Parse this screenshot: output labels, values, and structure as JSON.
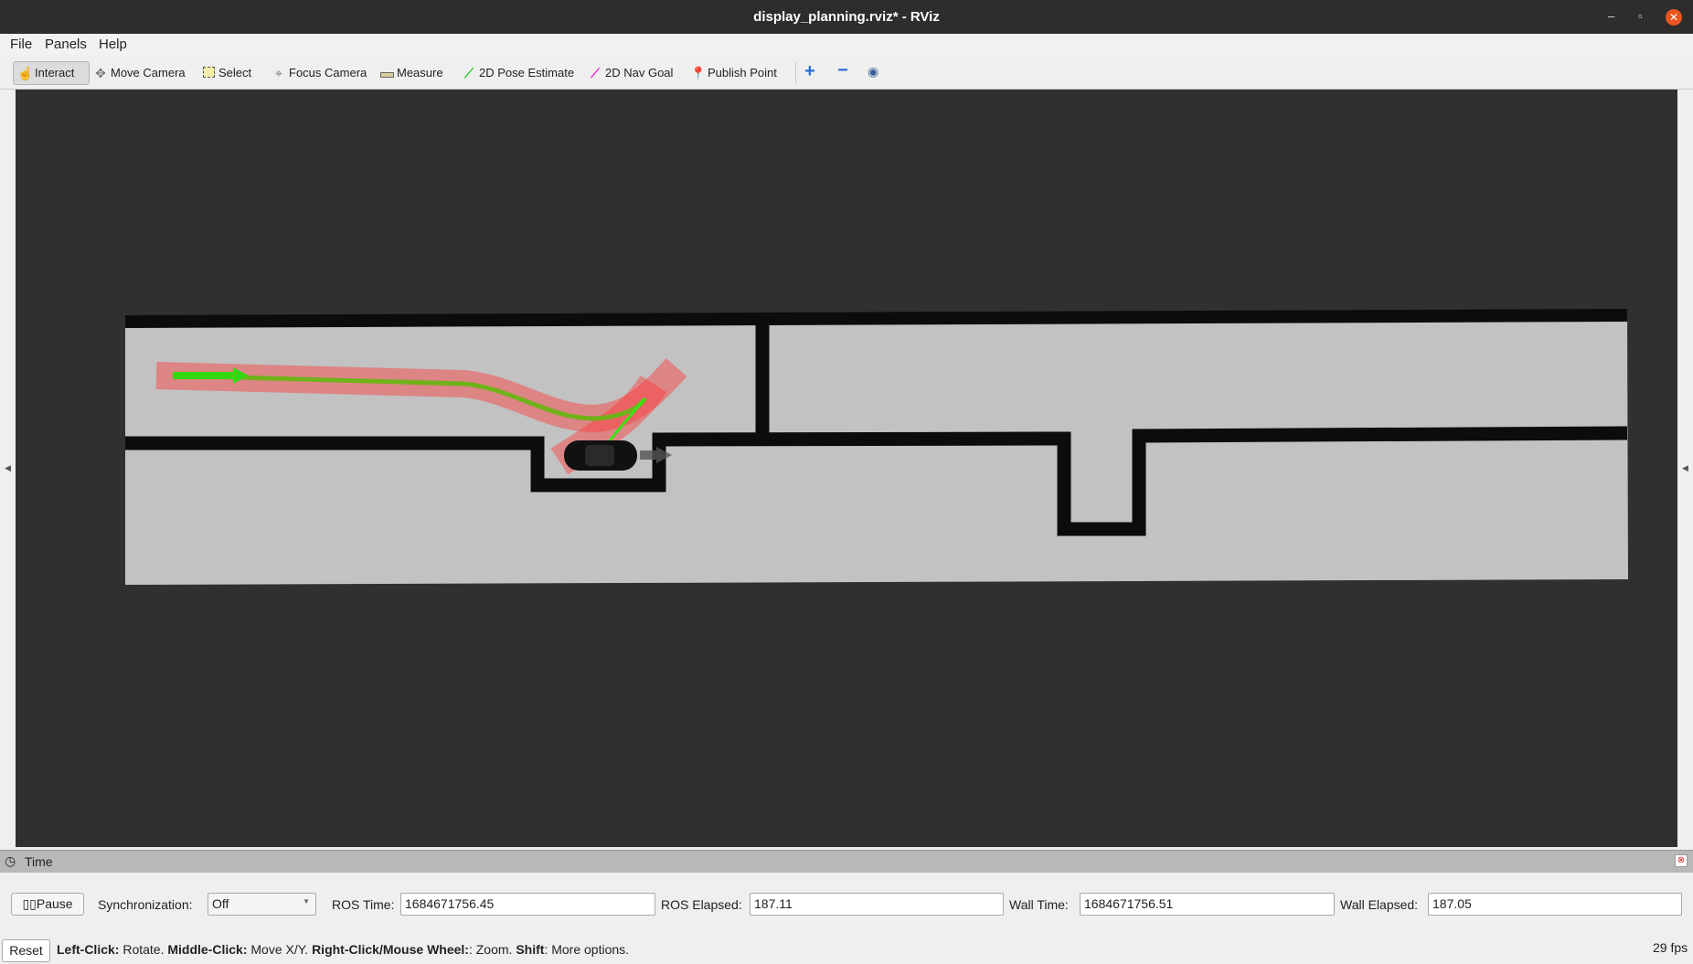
{
  "window": {
    "title": "display_planning.rviz* - RViz",
    "minimize": "–",
    "maximize": "▫",
    "close": "✕"
  },
  "menu": [
    {
      "label": "File"
    },
    {
      "label": "Panels"
    },
    {
      "label": "Help"
    }
  ],
  "toolbar": {
    "tools": [
      {
        "label": "Interact",
        "icon": "hand-pointer-icon",
        "active": true
      },
      {
        "label": "Move Camera",
        "icon": "move-camera-icon"
      },
      {
        "label": "Select",
        "icon": "select-box-icon"
      },
      {
        "label": "Focus Camera",
        "icon": "focus-camera-icon"
      },
      {
        "label": "Measure",
        "icon": "ruler-icon"
      },
      {
        "label": "2D Pose Estimate",
        "icon": "green-arrow-icon"
      },
      {
        "label": "2D Nav Goal",
        "icon": "magenta-arrow-icon"
      },
      {
        "label": "Publish Point",
        "icon": "map-pin-icon"
      }
    ],
    "extra": [
      "plus-icon",
      "minus-icon",
      "eye-icon"
    ]
  },
  "scene": {
    "colors": {
      "background": "#303030",
      "free": "#c2c2c2",
      "wall": "#0c0c0c",
      "path": "#37d612",
      "footprint": "#ff3a3a"
    }
  },
  "time_panel": {
    "title": "Time",
    "pause": "Pause",
    "sync_label": "Synchronization:",
    "sync_value": "Off",
    "ros_time_label": "ROS Time:",
    "ros_time": "1684671756.45",
    "ros_elapsed_label": "ROS Elapsed:",
    "ros_elapsed": "187.11",
    "wall_time_label": "Wall Time:",
    "wall_time": "1684671756.51",
    "wall_elapsed_label": "Wall Elapsed:",
    "wall_elapsed": "187.05"
  },
  "status": {
    "reset": "Reset",
    "hints": [
      {
        "key": "Left-Click:",
        "text": " Rotate. "
      },
      {
        "key": "Middle-Click:",
        "text": " Move X/Y. "
      },
      {
        "key": "Right-Click/Mouse Wheel:",
        "text": ": Zoom. "
      },
      {
        "key": "Shift",
        "text": ": More options."
      }
    ],
    "fps": "29 fps"
  }
}
